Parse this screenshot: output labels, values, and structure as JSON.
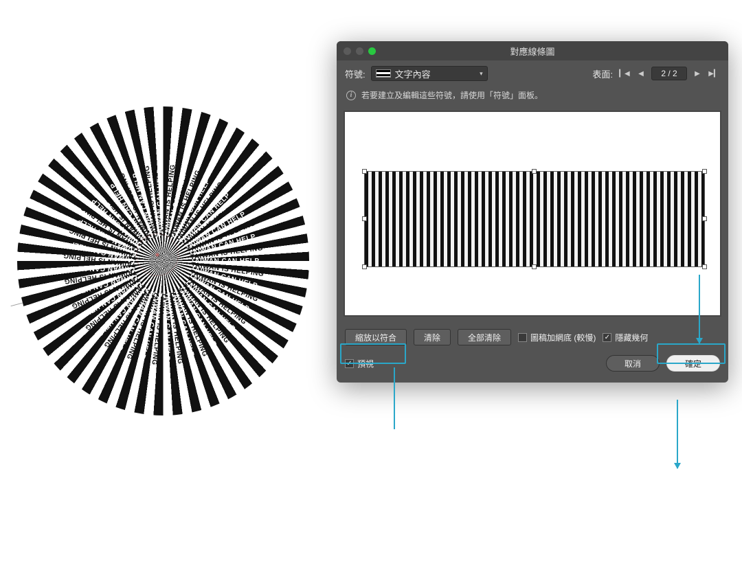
{
  "artwork": {
    "spoke_text_a": "TAIWAN CAN HELP",
    "spoke_text_b": "TAIWAN IS HELPING"
  },
  "dialog": {
    "title": "對應線條圖",
    "symbol_label": "符號:",
    "symbol_selected": "文字內容",
    "surface_label": "表面:",
    "pager_value": "2 / 2",
    "info_text": "若要建立及編輯這些符號，請使用「符號」面板。",
    "buttons": {
      "fit": "縮放以符合",
      "clear": "清除",
      "clear_all": "全部清除",
      "cancel": "取消",
      "ok": "確定"
    },
    "checkboxes": {
      "shade_label": "圖稿加網底 (較慢)",
      "shade_checked": false,
      "hide_geom_label": "隱藏幾何",
      "hide_geom_checked": true,
      "preview_label": "預視",
      "preview_checked": true
    }
  }
}
